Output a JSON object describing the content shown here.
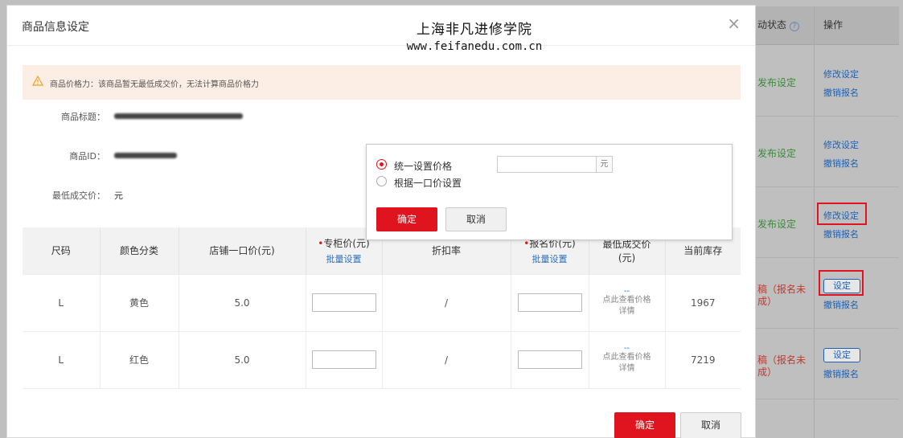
{
  "watermark": {
    "cn": "上海非凡进修学院",
    "en": "www.feifanedu.com.cn"
  },
  "background": {
    "status_header": "动状态",
    "op_header": "操作",
    "rows": [
      {
        "status": "发布设定",
        "status_color": "green",
        "action": "修改设定",
        "second": "撤销报名"
      },
      {
        "status": "发布设定",
        "status_color": "green",
        "action": "修改设定",
        "second": "撤销报名"
      },
      {
        "status": "发布设定",
        "status_color": "green",
        "action": "修改设定",
        "second": "撤销报名"
      },
      {
        "status_line1": "稿（报名未",
        "status_line2": "成）",
        "status_color": "red",
        "button": "设定",
        "second": "撤销报名"
      },
      {
        "status_line1": "稿（报名未",
        "status_line2": "成）",
        "status_color": "red",
        "button": "设定",
        "second": "撤销报名"
      }
    ]
  },
  "modal": {
    "title": "商品信息设定",
    "close": "×",
    "warning": "商品价格力：该商品暂无最低成交价，无法计算商品价格力",
    "title_label": "商品标题：",
    "id_label": "商品ID：",
    "min_price_label": "最低成交价：",
    "min_price_value": "元",
    "confirm": "确定",
    "cancel": "取消"
  },
  "table": {
    "headers": {
      "size": "尺码",
      "color": "颜色分类",
      "shop_price": "店铺一口价(元)",
      "counter_price": "专柜价(元)",
      "counter_batch": "批量设置",
      "discount": "折扣率",
      "signup_price": "报名价(元)",
      "signup_batch": "批量设置",
      "min_price_l1": "最低成交价",
      "min_price_l2": "(元)",
      "stock": "当前库存"
    },
    "rows": [
      {
        "size": "L",
        "color": "黄色",
        "shop_price": "5.0",
        "discount": "/",
        "price_dash": "--",
        "price_link_l1": "点此查看价格",
        "price_link_l2": "详情",
        "stock": "1967"
      },
      {
        "size": "L",
        "color": "红色",
        "shop_price": "5.0",
        "discount": "/",
        "price_dash": "--",
        "price_link_l1": "点此查看价格",
        "price_link_l2": "详情",
        "stock": "7219"
      }
    ]
  },
  "popup": {
    "option1": "统一设置价格",
    "option2": "根据一口价设置",
    "unit": "元",
    "confirm": "确定",
    "cancel": "取消"
  },
  "colors": {
    "accent": "#e0141e",
    "link": "#2a6fbe",
    "warning_bg": "#fdeee5"
  }
}
